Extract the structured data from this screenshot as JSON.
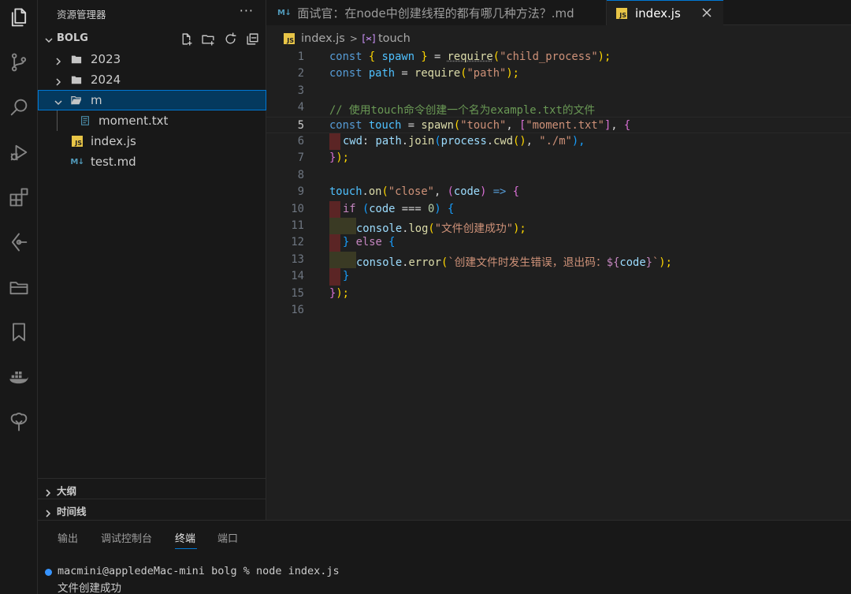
{
  "sidebar": {
    "title": "资源管理器",
    "more": "···",
    "workspace": "BOLG",
    "tree": [
      {
        "label": "2023",
        "type": "folder"
      },
      {
        "label": "2024",
        "type": "folder"
      },
      {
        "label": "m",
        "type": "folder-open"
      },
      {
        "label": "moment.txt",
        "type": "file-txt"
      },
      {
        "label": "index.js",
        "type": "file-js"
      },
      {
        "label": "test.md",
        "type": "file-md"
      }
    ],
    "outline": "大纲",
    "timeline": "时间线"
  },
  "tabs": [
    {
      "label": "面试官：在node中创建线程的都有哪几种方法？.md",
      "icon": "M↓"
    },
    {
      "label": "index.js",
      "icon": "JS"
    }
  ],
  "breadcrumb": {
    "file": "index.js",
    "symbol": "touch"
  },
  "icons": {
    "js": "JS",
    "md": "M↓"
  },
  "editor": {
    "line_numbers": [
      "1",
      "2",
      "3",
      "4",
      "5",
      "6",
      "7",
      "8",
      "9",
      "10",
      "11",
      "12",
      "13",
      "14",
      "15",
      "16"
    ],
    "code": {
      "l1": {
        "kw": "const",
        "b1": "{",
        "v": "spawn",
        "b2": "}",
        "op": "=",
        "fn": "require",
        "p1": "(",
        "s": "\"child_process\"",
        "p2": ");"
      },
      "l2": {
        "kw": "const",
        "v": "path",
        "op": "=",
        "fn": "require",
        "p1": "(",
        "s": "\"path\"",
        "p2": ");"
      },
      "l4": {
        "comment": "// 使用touch命令创建一个名为example.txt的文件"
      },
      "l5": {
        "kw": "const",
        "v": "touch",
        "op": "=",
        "fn": "spawn",
        "p1": "(",
        "s1": "\"touch\"",
        "comma": ",",
        "br1": "[",
        "s2": "\"moment.txt\"",
        "br2": "]",
        "comma2": ",",
        "cb": "{"
      },
      "l6": {
        "v1": "cwd",
        "colon": ":",
        "v2": "path",
        "dot": ".",
        "fn1": "join",
        "p1": "(",
        "v3": "process",
        "dot2": ".",
        "fn2": "cwd",
        "p2": "()",
        "comma": ",",
        "s": "\"./m\"",
        "p3": "),"
      },
      "l7": {
        "cb": "}",
        "p": ");"
      },
      "l9": {
        "v": "touch",
        "dot": ".",
        "fn": "on",
        "p1": "(",
        "s": "\"close\"",
        "comma": ",",
        "p2": "(",
        "param": "code",
        "p3": ")",
        "arrow": "=>",
        "cb": "{"
      },
      "l10": {
        "kw": "if",
        "p1": "(",
        "v": "code",
        "op": "===",
        "num": "0",
        "p2": ")",
        "cb": "{"
      },
      "l11": {
        "v": "console",
        "dot": ".",
        "fn": "log",
        "p1": "(",
        "s": "\"文件创建成功\"",
        "p2": ");"
      },
      "l12": {
        "cb1": "}",
        "kw": "else",
        "cb2": "{"
      },
      "l13": {
        "v": "console",
        "dot": ".",
        "fn": "error",
        "p1": "(",
        "s1": "`创建文件时发生错误，退出码：",
        "tpl1": "${",
        "param": "code",
        "tpl2": "}",
        "s2": "`",
        "p2": ");"
      },
      "l14": {
        "cb": "}"
      },
      "l15": {
        "cb": "}",
        "p": ");"
      }
    }
  },
  "panel": {
    "tabs": [
      "输出",
      "调试控制台",
      "终端",
      "端口"
    ],
    "active_tab": "终端",
    "terminal": [
      "macmini@appledeMac-mini bolg % node index.js",
      "文件创建成功"
    ]
  },
  "colors": {
    "accent": "#0078d4",
    "selection_bg": "#04395e",
    "js_icon": "#e8c547",
    "md_icon": "#519aba"
  }
}
